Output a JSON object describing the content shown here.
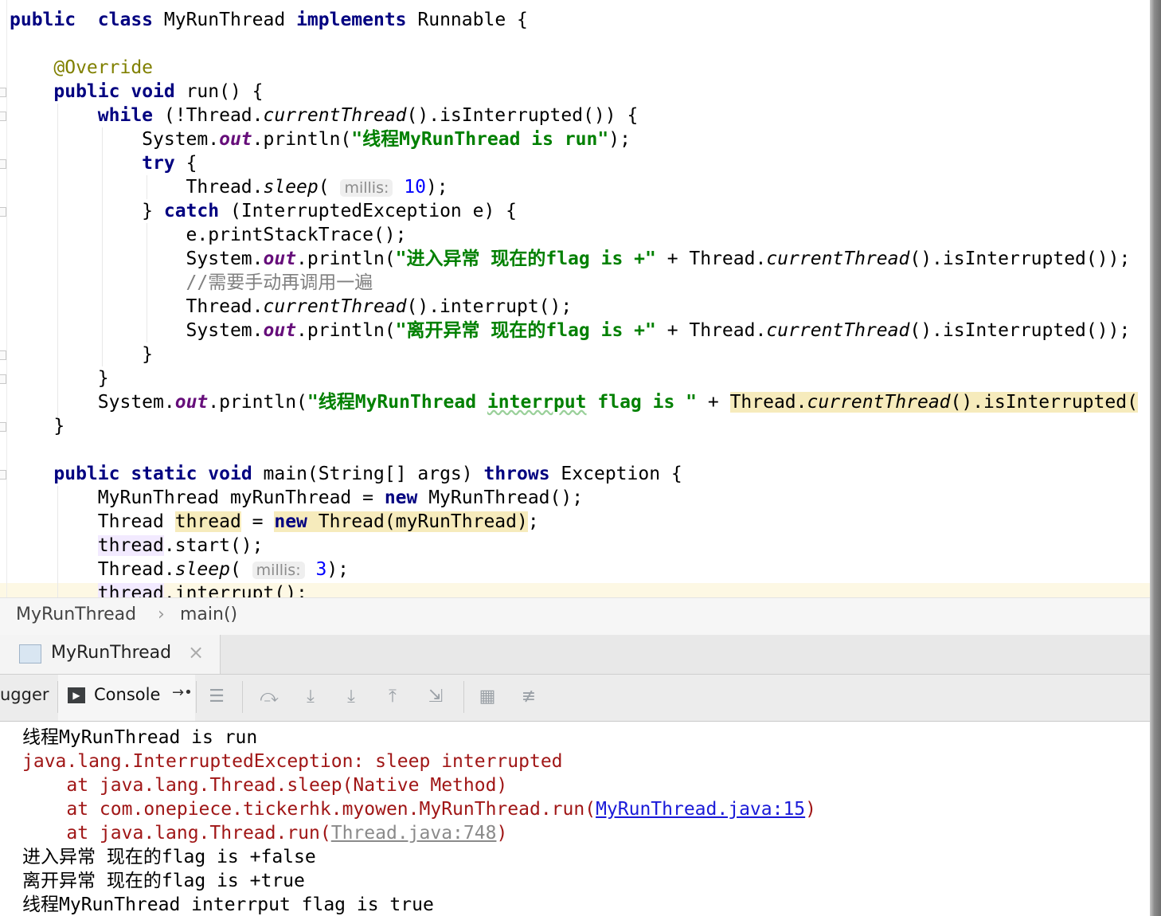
{
  "editor": {
    "lines": [
      {
        "segments": [
          [
            "kw",
            "public"
          ],
          [
            "",
            "  "
          ],
          [
            "kw",
            "class"
          ],
          [
            "",
            " MyRunThread "
          ],
          [
            "kw",
            "implements"
          ],
          [
            "",
            " Runnable {"
          ]
        ]
      },
      {
        "segments": [
          [
            "ann",
            "    @Override"
          ]
        ]
      },
      {
        "segments": [
          [
            "",
            "    "
          ],
          [
            "kw",
            "public"
          ],
          [
            "",
            " "
          ],
          [
            "kw",
            "void"
          ],
          [
            "",
            " run() {"
          ]
        ]
      },
      {
        "segments": [
          [
            "",
            "        "
          ],
          [
            "kw",
            "while"
          ],
          [
            "",
            " (!Thread."
          ],
          [
            "it",
            "currentThread"
          ],
          [
            "",
            "().isInterrupted()) {"
          ]
        ]
      },
      {
        "segments": [
          [
            "",
            "            System."
          ],
          [
            "fld",
            "out"
          ],
          [
            "",
            ".println("
          ],
          [
            "str",
            "\"线程MyRunThread is run\""
          ],
          [
            "",
            ");"
          ]
        ]
      },
      {
        "segments": [
          [
            "",
            "            "
          ],
          [
            "kw",
            "try"
          ],
          [
            "",
            " {"
          ]
        ]
      },
      {
        "segments": [
          [
            "",
            "                Thread."
          ],
          [
            "it",
            "sleep"
          ],
          [
            "",
            "( "
          ],
          [
            "hint",
            "millis:"
          ],
          [
            "",
            " "
          ],
          [
            "num",
            "10"
          ],
          [
            "",
            ");"
          ]
        ]
      },
      {
        "segments": [
          [
            "",
            "            } "
          ],
          [
            "kw",
            "catch"
          ],
          [
            "",
            " (InterruptedException e) {"
          ]
        ]
      },
      {
        "segments": [
          [
            "",
            "                e.printStackTrace();"
          ]
        ]
      },
      {
        "segments": [
          [
            "",
            "                System."
          ],
          [
            "fld",
            "out"
          ],
          [
            "",
            ".println("
          ],
          [
            "str",
            "\"进入异常 现在的flag is +\""
          ],
          [
            "",
            " + Thread."
          ],
          [
            "it",
            "currentThread"
          ],
          [
            "",
            "().isInterrupted());"
          ]
        ]
      },
      {
        "segments": [
          [
            "cmt",
            "                //需要手动再调用一遍"
          ]
        ]
      },
      {
        "segments": [
          [
            "",
            "                Thread."
          ],
          [
            "it",
            "currentThread"
          ],
          [
            "",
            "().interrupt();"
          ]
        ]
      },
      {
        "segments": [
          [
            "",
            "                System."
          ],
          [
            "fld",
            "out"
          ],
          [
            "",
            ".println("
          ],
          [
            "str",
            "\"离开异常 现在的flag is +\""
          ],
          [
            "",
            " + Thread."
          ],
          [
            "it",
            "currentThread"
          ],
          [
            "",
            "().isInterrupted());"
          ]
        ]
      },
      {
        "segments": [
          [
            "",
            "            }"
          ]
        ]
      },
      {
        "segments": [
          [
            "",
            "        }"
          ]
        ]
      },
      {
        "segments": [
          [
            "",
            "        System."
          ],
          [
            "fld",
            "out"
          ],
          [
            "",
            ".println("
          ],
          [
            "str",
            "\"线程MyRunThread "
          ],
          [
            "str typo",
            "interrput"
          ],
          [
            "str",
            " flag is \""
          ],
          [
            "",
            " + "
          ],
          [
            "hl",
            "Thread."
          ],
          [
            "hl it",
            "currentThread"
          ],
          [
            "hl",
            "().isInterrupted("
          ]
        ]
      },
      {
        "segments": [
          [
            "",
            "    }"
          ]
        ]
      },
      {
        "segments": [
          [
            "",
            "    "
          ],
          [
            "kw",
            "public"
          ],
          [
            "",
            " "
          ],
          [
            "kw",
            "static"
          ],
          [
            "",
            " "
          ],
          [
            "kw",
            "void"
          ],
          [
            "",
            " main(String[] args) "
          ],
          [
            "kw",
            "throws"
          ],
          [
            "",
            " Exception {"
          ]
        ]
      },
      {
        "segments": [
          [
            "",
            "        MyRunThread myRunThread = "
          ],
          [
            "kw",
            "new"
          ],
          [
            "",
            " MyRunThread();"
          ]
        ]
      },
      {
        "segments": [
          [
            "",
            "        Thread "
          ],
          [
            "hl",
            "thread"
          ],
          [
            "",
            " = "
          ],
          [
            "hl kw",
            "new"
          ],
          [
            "hl",
            " Thread(myRunThread)"
          ],
          [
            "",
            ";"
          ]
        ]
      },
      {
        "segments": [
          [
            "",
            "        "
          ],
          [
            "hlw",
            "thread"
          ],
          [
            "",
            ".start();"
          ]
        ]
      },
      {
        "segments": [
          [
            "",
            "        Thread."
          ],
          [
            "it",
            "sleep"
          ],
          [
            "",
            "( "
          ],
          [
            "hint",
            "millis:"
          ],
          [
            "",
            " "
          ],
          [
            "num",
            "3"
          ],
          [
            "",
            ");"
          ]
        ]
      },
      {
        "segments": [
          [
            "",
            "        "
          ],
          [
            "hlw",
            "thread"
          ],
          [
            "",
            ".interrupt();"
          ]
        ]
      }
    ]
  },
  "breadcrumb": {
    "class_name": "MyRunThread",
    "separator": "›",
    "method": "main()"
  },
  "run_tab": {
    "title": "MyRunThread",
    "close": "×"
  },
  "toolbar": {
    "debugger_label": "ugger",
    "console_label": "Console",
    "console_icon": "▶",
    "restore_icon": "→•"
  },
  "console": {
    "lines": [
      {
        "segments": [
          [
            "",
            "线程MyRunThread is run"
          ]
        ]
      },
      {
        "segments": [
          [
            "err",
            "java.lang.InterruptedException: sleep interrupted"
          ]
        ]
      },
      {
        "segments": [
          [
            "err",
            "    at java.lang.Thread.sleep(Native Method)"
          ]
        ]
      },
      {
        "segments": [
          [
            "err",
            "    at com.onepiece.tickerhk.myowen.MyRunThread.run("
          ],
          [
            "link",
            "MyRunThread.java:15"
          ],
          [
            "err",
            ")"
          ]
        ]
      },
      {
        "segments": [
          [
            "err",
            "    at java.lang.Thread.run("
          ],
          [
            "link-gray",
            "Thread.java:748"
          ],
          [
            "err",
            ")"
          ]
        ]
      },
      {
        "segments": [
          [
            "",
            "进入异常 现在的flag is +false"
          ]
        ]
      },
      {
        "segments": [
          [
            "",
            "离开异常 现在的flag is +true"
          ]
        ]
      },
      {
        "segments": [
          [
            "",
            "线程MyRunThread interrput flag is true"
          ]
        ]
      }
    ]
  },
  "colors": {
    "keyword": "#000080",
    "string": "#008000",
    "field": "#660e7a",
    "annotation": "#808000",
    "number": "#0000ff",
    "error": "#a01616",
    "link": "#1a1ad8"
  }
}
